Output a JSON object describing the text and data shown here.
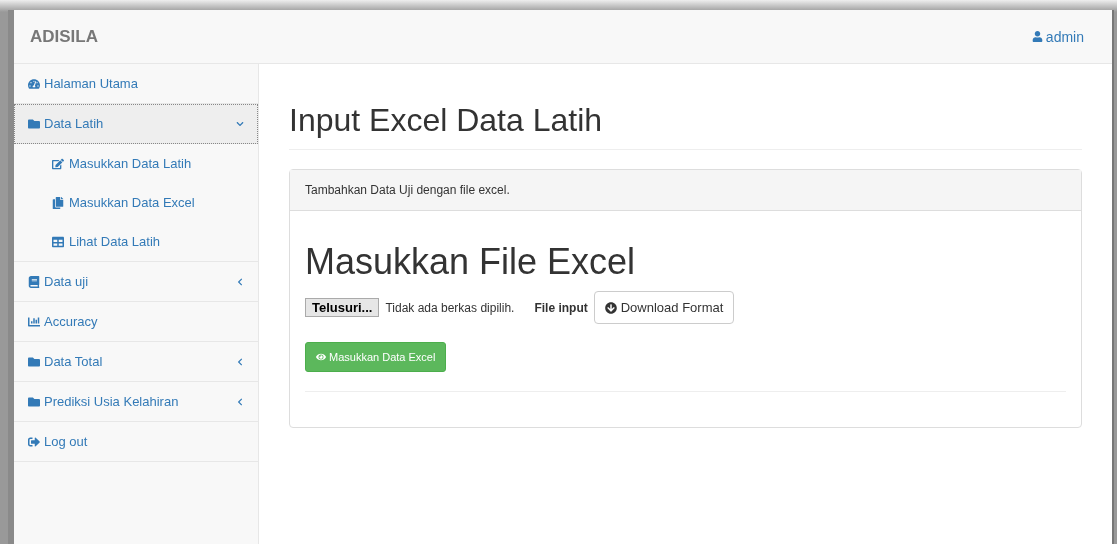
{
  "navbar": {
    "brand": "ADISILA",
    "user": "admin"
  },
  "sidebar": {
    "items": [
      {
        "label": "Halaman Utama",
        "selected": false
      },
      {
        "label": "Data Latih",
        "selected": true,
        "expanded": true,
        "children": [
          {
            "label": "Masukkan Data Latih"
          },
          {
            "label": "Masukkan Data Excel"
          },
          {
            "label": "Lihat Data Latih"
          }
        ]
      },
      {
        "label": "Data uji",
        "selected": false,
        "expanded": false
      },
      {
        "label": "Accuracy",
        "selected": false
      },
      {
        "label": "Data Total",
        "selected": false,
        "expanded": false
      },
      {
        "label": "Prediksi Usia Kelahiran",
        "selected": false,
        "expanded": false
      },
      {
        "label": "Log out",
        "selected": false
      }
    ]
  },
  "page": {
    "title": "Input Excel Data Latih",
    "panel": {
      "heading": "Tambahkan Data Uji dengan file excel.",
      "title": "Masukkan File Excel",
      "file_button": "Telusuri...",
      "file_status": "Tidak ada berkas dipilih.",
      "file_label": "File input",
      "download_button": "Download Format",
      "submit_button": "Masukkan Data Excel"
    }
  }
}
